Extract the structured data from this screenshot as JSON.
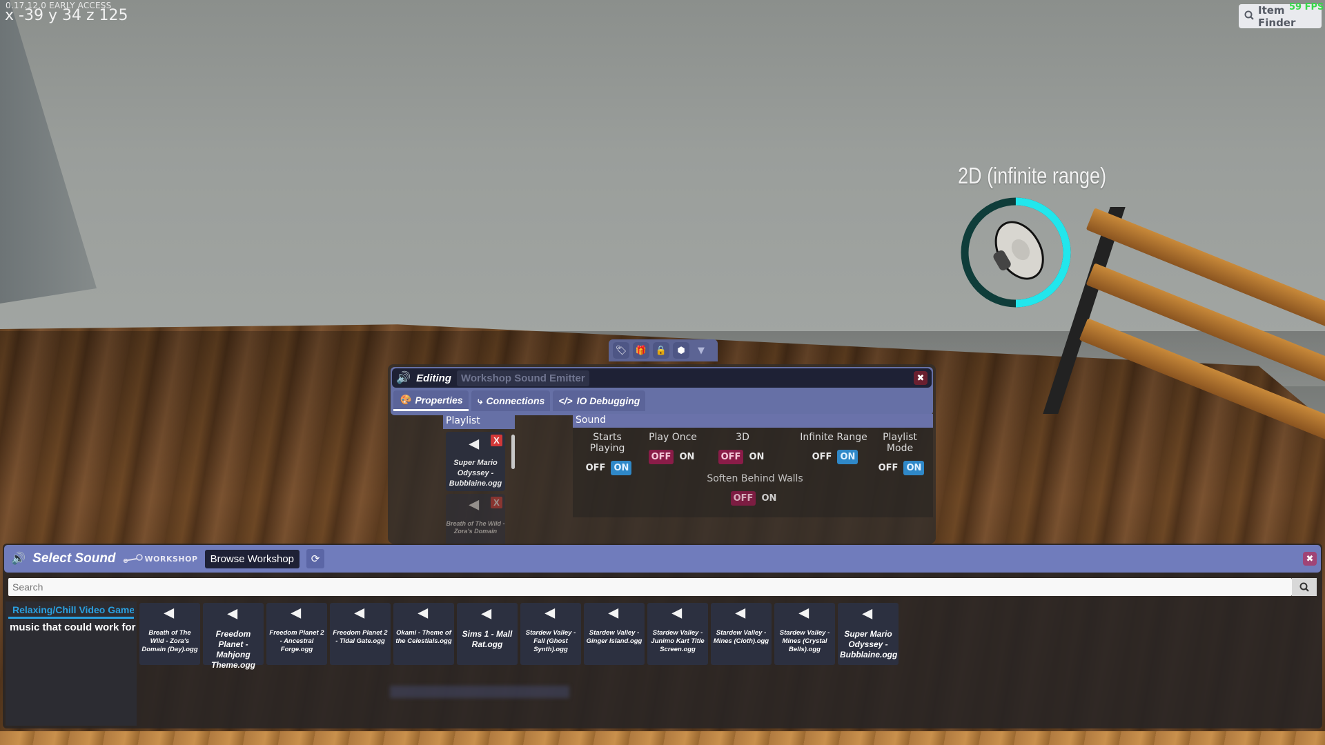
{
  "hud": {
    "version": "0.17.12.0 EARLY ACCESS",
    "coords": "x -39 y 34 z 125",
    "item_finder": "Item Finder",
    "fps": "59 FPS"
  },
  "emitter": {
    "label": "2D (infinite range)",
    "ring_progress": 0.5,
    "ring_color_active": "#22e6ec",
    "ring_color_track": "#0f3d3a"
  },
  "object_toolbar": {
    "buttons": [
      "tag-icon",
      "gift-icon",
      "lock-icon",
      "cube-icon",
      "dropdown-triangle-icon"
    ]
  },
  "edit_window": {
    "title": "Editing",
    "object_name": "Workshop Sound Emitter",
    "tabs": [
      {
        "label": "Properties",
        "icon": "palette-icon",
        "active": true
      },
      {
        "label": "Connections",
        "icon": "plug-icon",
        "active": false
      },
      {
        "label": "IO Debugging",
        "icon": "code-icon",
        "active": false
      }
    ],
    "playlist": {
      "header": "Playlist",
      "items": [
        {
          "name": "Super Mario Odyssey - Bubblaine.ogg"
        },
        {
          "name": "Breath of The Wild - Zora's Domain"
        }
      ]
    },
    "sound": {
      "header": "Sound",
      "off_label": "OFF",
      "on_label": "ON",
      "toggles": [
        {
          "label": "Starts Playing",
          "value": "ON"
        },
        {
          "label": "Play Once",
          "value": "OFF"
        },
        {
          "label": "3D",
          "value": "OFF"
        },
        {
          "label": "Infinite Range",
          "value": "ON"
        },
        {
          "label": "Playlist Mode",
          "value": "ON"
        },
        {
          "label": "Soften Behind Walls",
          "value": "OFF"
        }
      ]
    }
  },
  "select_sound": {
    "title": "Select Sound",
    "workshop_logo": "WORKSHOP",
    "browse_label": "Browse Workshop",
    "search_placeholder": "Search",
    "category": {
      "title": "Relaxing/Chill Video Game",
      "description": "music that could work for"
    },
    "tiles": [
      "Breath of The Wild - Zora's Domain (Day).ogg",
      "Freedom Planet - Mahjong Theme.ogg",
      "Freedom Planet 2 - Ancestral Forge.ogg",
      "Freedom Planet 2 - Tidal Gate.ogg",
      "Okami - Theme of the Celestials.ogg",
      "Sims 1 - Mall Rat.ogg",
      "Stardew Valley - Fall (Ghost Synth).ogg",
      "Stardew Valley - Ginger Island.ogg",
      "Stardew Valley - Junimo Kart Title Screen.ogg",
      "Stardew Valley - Mines (Cloth).ogg",
      "Stardew Valley - Mines (Crystal Bells).ogg",
      "Super Mario Odyssey - Bubblaine.ogg"
    ]
  }
}
